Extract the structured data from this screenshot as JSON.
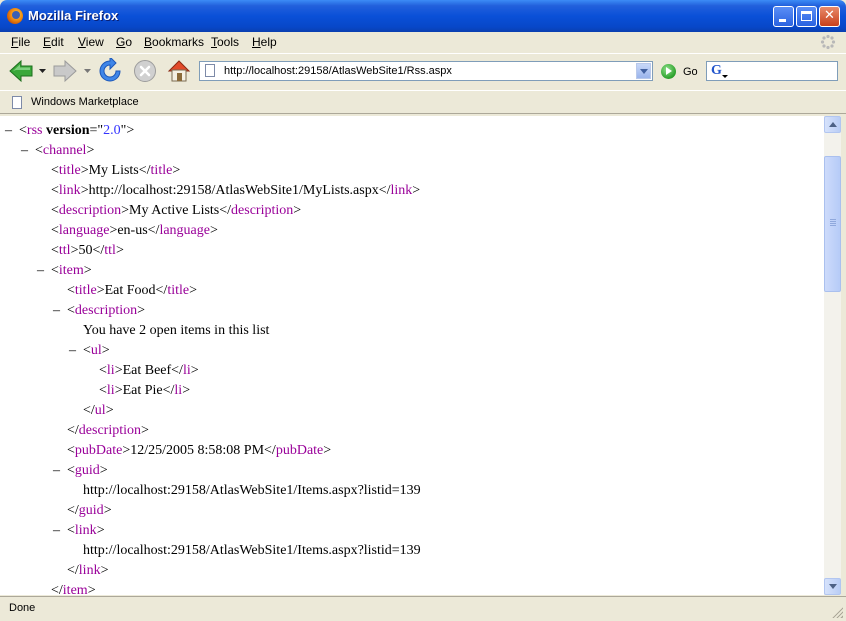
{
  "window": {
    "title": "Mozilla Firefox"
  },
  "menu": [
    {
      "pre": "",
      "u": "F",
      "post": "ile"
    },
    {
      "pre": "",
      "u": "E",
      "post": "dit"
    },
    {
      "pre": "",
      "u": "V",
      "post": "iew"
    },
    {
      "pre": "",
      "u": "G",
      "post": "o"
    },
    {
      "pre": "",
      "u": "B",
      "post": "ookmarks"
    },
    {
      "pre": "",
      "u": "T",
      "post": "ools"
    },
    {
      "pre": "",
      "u": "H",
      "post": "elp"
    }
  ],
  "navbar": {
    "url": "http://localhost:29158/AtlasWebSite1/Rss.aspx",
    "go_label": "Go",
    "icons": [
      "back-icon",
      "forward-icon",
      "reload-icon",
      "stop-icon",
      "home-icon"
    ]
  },
  "bookmarks": {
    "items": [
      "Windows Marketplace"
    ]
  },
  "xml": {
    "lines": [
      [
        {
          "t": "mk",
          "v": "– "
        },
        {
          "t": "p",
          "v": "<"
        },
        {
          "t": "tg",
          "v": "rss"
        },
        {
          "t": "p",
          "v": " "
        },
        {
          "t": "an",
          "v": "version"
        },
        {
          "t": "p",
          "v": "=\""
        },
        {
          "t": "av",
          "v": "2.0"
        },
        {
          "t": "p",
          "v": "\">"
        }
      ],
      [
        {
          "t": "mk",
          "v": "– "
        },
        {
          "t": "p",
          "v": "<"
        },
        {
          "t": "tg",
          "v": "channel"
        },
        {
          "t": "p",
          "v": ">"
        }
      ],
      [
        {
          "t": "p",
          "v": "<"
        },
        {
          "t": "tg",
          "v": "title"
        },
        {
          "t": "p",
          "v": ">My Lists</"
        },
        {
          "t": "tg",
          "v": "title"
        },
        {
          "t": "p",
          "v": ">"
        }
      ],
      [
        {
          "t": "p",
          "v": "<"
        },
        {
          "t": "tg",
          "v": "link"
        },
        {
          "t": "p",
          "v": ">http://localhost:29158/AtlasWebSite1/MyLists.aspx</"
        },
        {
          "t": "tg",
          "v": "link"
        },
        {
          "t": "p",
          "v": ">"
        }
      ],
      [
        {
          "t": "p",
          "v": "<"
        },
        {
          "t": "tg",
          "v": "description"
        },
        {
          "t": "p",
          "v": ">My Active Lists</"
        },
        {
          "t": "tg",
          "v": "description"
        },
        {
          "t": "p",
          "v": ">"
        }
      ],
      [
        {
          "t": "p",
          "v": "<"
        },
        {
          "t": "tg",
          "v": "language"
        },
        {
          "t": "p",
          "v": ">en-us</"
        },
        {
          "t": "tg",
          "v": "language"
        },
        {
          "t": "p",
          "v": ">"
        }
      ],
      [
        {
          "t": "p",
          "v": "<"
        },
        {
          "t": "tg",
          "v": "ttl"
        },
        {
          "t": "p",
          "v": ">50</"
        },
        {
          "t": "tg",
          "v": "ttl"
        },
        {
          "t": "p",
          "v": ">"
        }
      ],
      [
        {
          "t": "mk",
          "v": "– "
        },
        {
          "t": "p",
          "v": "<"
        },
        {
          "t": "tg",
          "v": "item"
        },
        {
          "t": "p",
          "v": ">"
        }
      ],
      [
        {
          "t": "p",
          "v": "<"
        },
        {
          "t": "tg",
          "v": "title"
        },
        {
          "t": "p",
          "v": ">Eat Food</"
        },
        {
          "t": "tg",
          "v": "title"
        },
        {
          "t": "p",
          "v": ">"
        }
      ],
      [
        {
          "t": "mk",
          "v": "– "
        },
        {
          "t": "p",
          "v": "<"
        },
        {
          "t": "tg",
          "v": "description"
        },
        {
          "t": "p",
          "v": ">"
        }
      ],
      [
        {
          "t": "p",
          "v": "You have 2 open items in this list"
        }
      ],
      [
        {
          "t": "mk",
          "v": "– "
        },
        {
          "t": "p",
          "v": "<"
        },
        {
          "t": "tg",
          "v": "ul"
        },
        {
          "t": "p",
          "v": ">"
        }
      ],
      [
        {
          "t": "p",
          "v": "<"
        },
        {
          "t": "tg",
          "v": "li"
        },
        {
          "t": "p",
          "v": ">Eat Beef</"
        },
        {
          "t": "tg",
          "v": "li"
        },
        {
          "t": "p",
          "v": ">"
        }
      ],
      [
        {
          "t": "p",
          "v": "<"
        },
        {
          "t": "tg",
          "v": "li"
        },
        {
          "t": "p",
          "v": ">Eat Pie</"
        },
        {
          "t": "tg",
          "v": "li"
        },
        {
          "t": "p",
          "v": ">"
        }
      ],
      [
        {
          "t": "p",
          "v": "</"
        },
        {
          "t": "tg",
          "v": "ul"
        },
        {
          "t": "p",
          "v": ">"
        }
      ],
      [
        {
          "t": "p",
          "v": "</"
        },
        {
          "t": "tg",
          "v": "description"
        },
        {
          "t": "p",
          "v": ">"
        }
      ],
      [
        {
          "t": "p",
          "v": "<"
        },
        {
          "t": "tg",
          "v": "pubDate"
        },
        {
          "t": "p",
          "v": ">12/25/2005 8:58:08 PM</"
        },
        {
          "t": "tg",
          "v": "pubDate"
        },
        {
          "t": "p",
          "v": ">"
        }
      ],
      [
        {
          "t": "mk",
          "v": "– "
        },
        {
          "t": "p",
          "v": "<"
        },
        {
          "t": "tg",
          "v": "guid"
        },
        {
          "t": "p",
          "v": ">"
        }
      ],
      [
        {
          "t": "p",
          "v": "http://localhost:29158/AtlasWebSite1/Items.aspx?listid=139"
        }
      ],
      [
        {
          "t": "p",
          "v": "</"
        },
        {
          "t": "tg",
          "v": "guid"
        },
        {
          "t": "p",
          "v": ">"
        }
      ],
      [
        {
          "t": "mk",
          "v": "– "
        },
        {
          "t": "p",
          "v": "<"
        },
        {
          "t": "tg",
          "v": "link"
        },
        {
          "t": "p",
          "v": ">"
        }
      ],
      [
        {
          "t": "p",
          "v": "http://localhost:29158/AtlasWebSite1/Items.aspx?listid=139"
        }
      ],
      [
        {
          "t": "p",
          "v": "</"
        },
        {
          "t": "tg",
          "v": "link"
        },
        {
          "t": "p",
          "v": ">"
        }
      ],
      [
        {
          "t": "p",
          "v": "</"
        },
        {
          "t": "tg",
          "v": "item"
        },
        {
          "t": "p",
          "v": ">"
        }
      ]
    ]
  },
  "status": {
    "text": "Done"
  },
  "colors": {
    "tag": "#990099",
    "attr_value": "#3333ff",
    "titlebar": "#0a50d8"
  }
}
